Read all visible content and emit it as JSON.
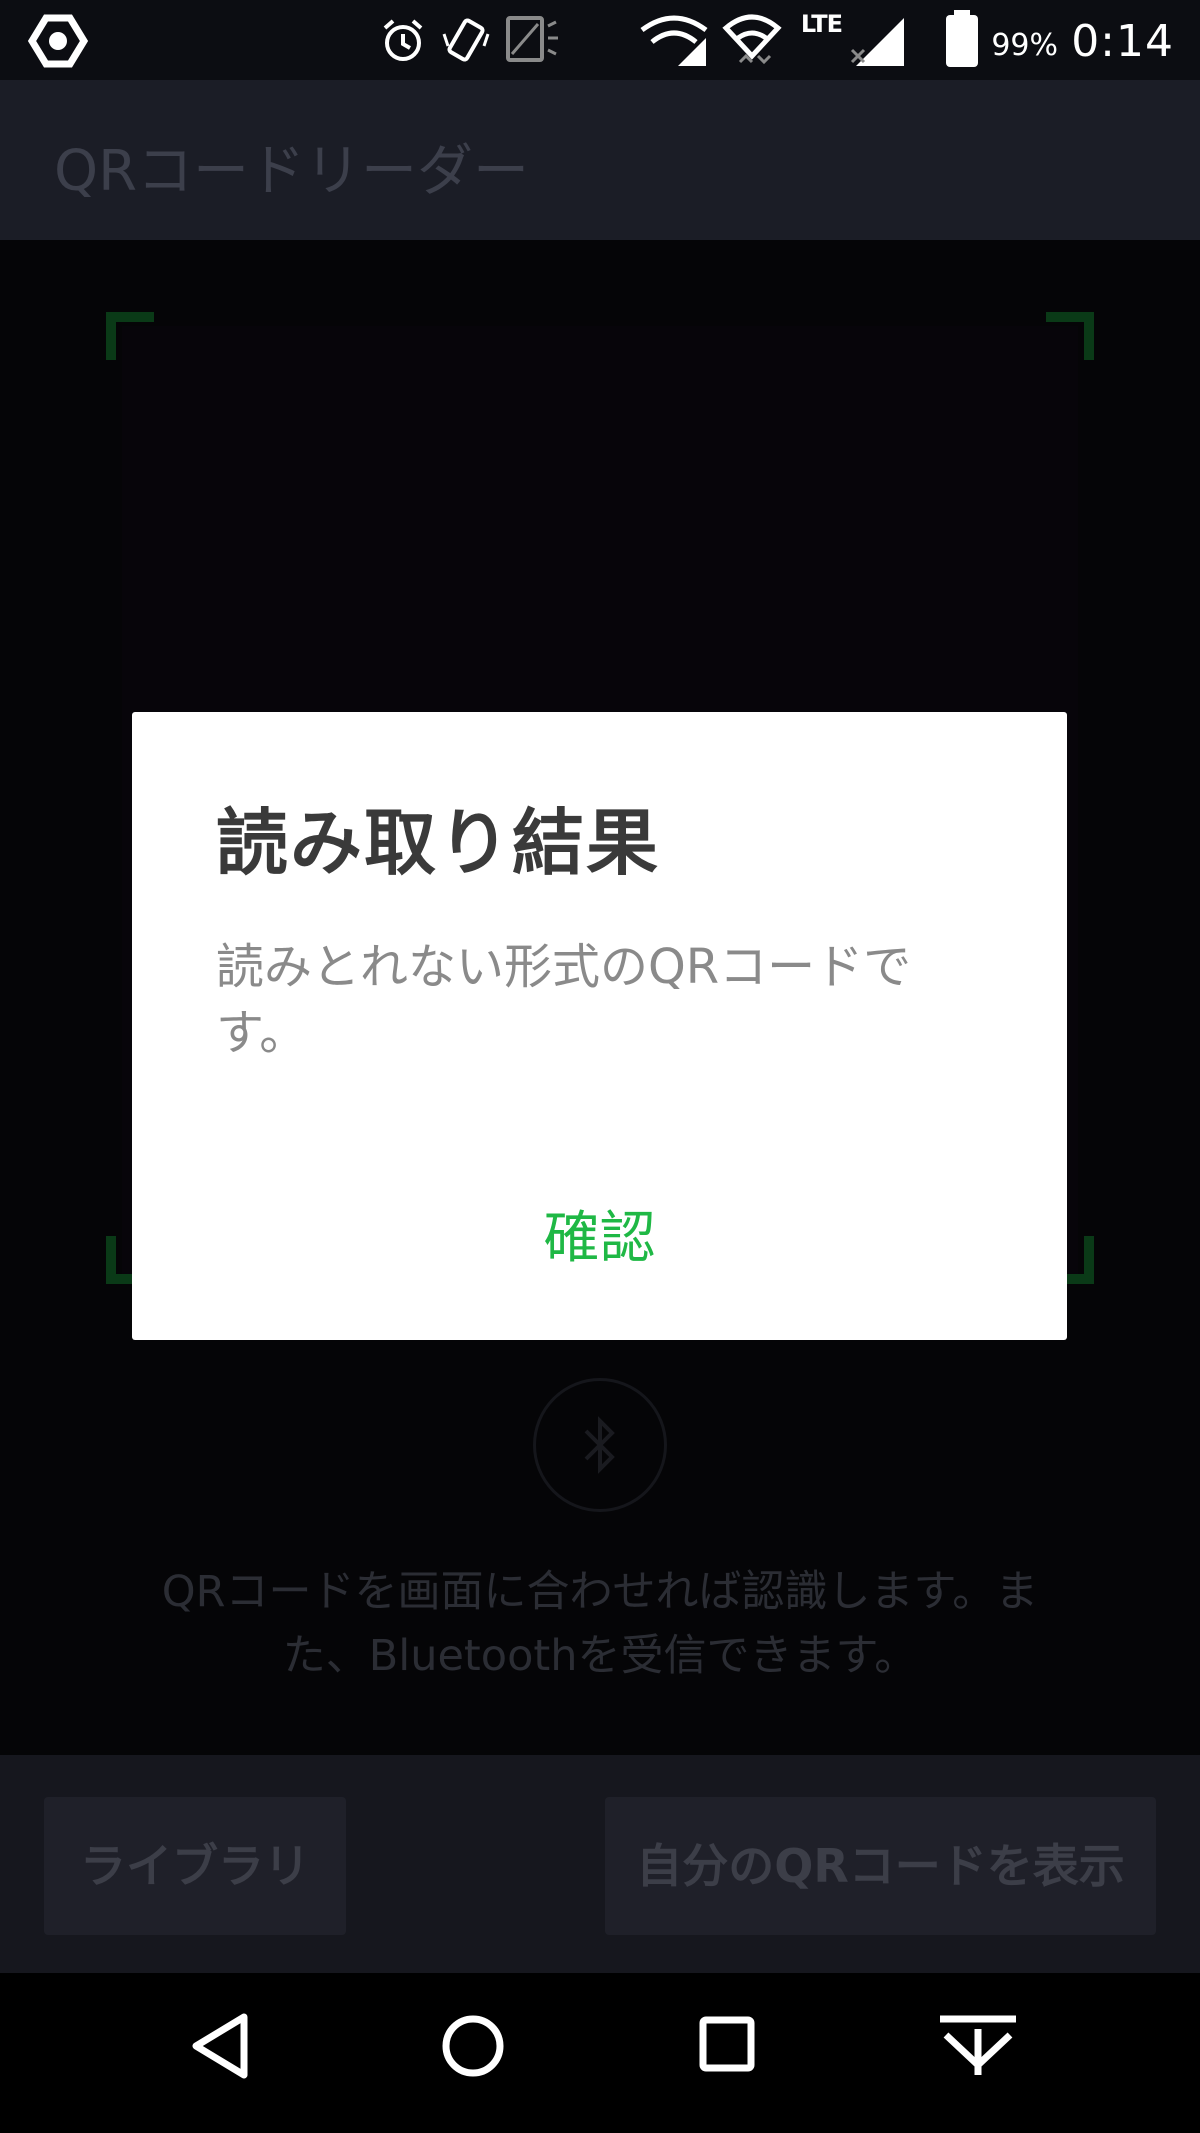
{
  "status_bar": {
    "battery_percent": "99%",
    "time": "0:14",
    "network_label": "LTE",
    "icons": [
      "app-sync-icon",
      "alarm-icon",
      "vibrate-icon",
      "nfc-icon",
      "wifi-call-icon",
      "wifi-icon",
      "lte-signal-icon",
      "battery-icon"
    ]
  },
  "app_bar": {
    "title": "QRコードリーダー"
  },
  "scanner": {
    "hint_line1": "QRコードを画面に合わせれば認識します。ま",
    "hint_line2": "た、Bluetoothを受信できます。",
    "bluetooth_icon": "bluetooth-icon",
    "frame_color": "#0a3a17"
  },
  "bottom_bar": {
    "library_label": "ライブラリ",
    "my_qr_label": "自分のQRコードを表示"
  },
  "dialog": {
    "title": "読み取り結果",
    "message_line1": "読みとれない形式のQRコードで",
    "message_line2": "す。",
    "confirm_label": "確認",
    "confirm_color": "#1fb845"
  },
  "nav_bar": {
    "icons": [
      "back-icon",
      "home-icon",
      "recents-icon",
      "notification-pull-icon"
    ]
  }
}
